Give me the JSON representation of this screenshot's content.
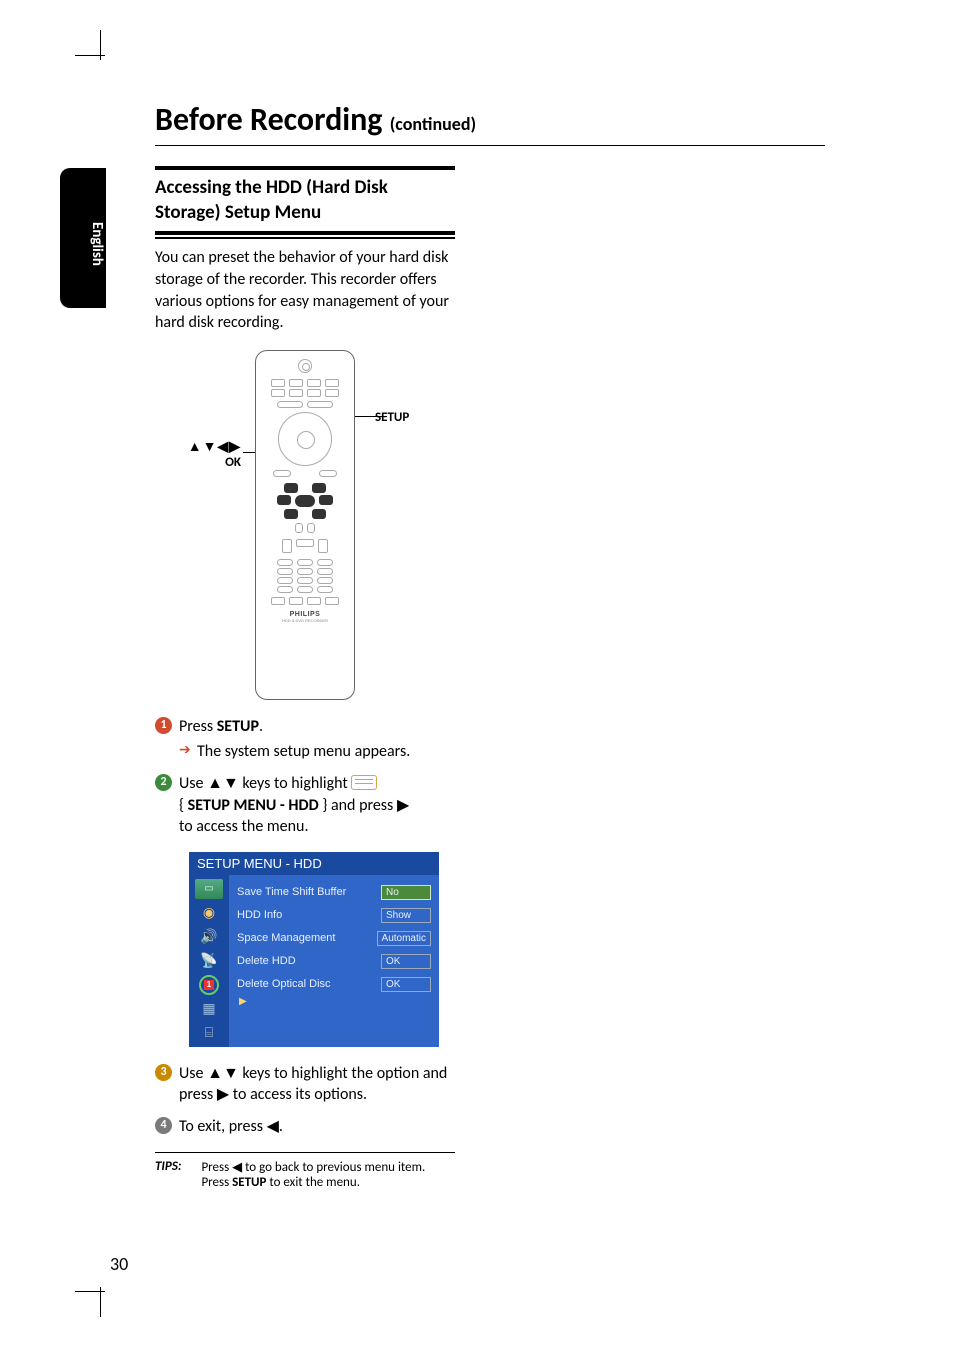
{
  "language_tab": "English",
  "title_main": "Before Recording",
  "title_cont": "(continued)",
  "section_heading": "Accessing the  HDD (Hard Disk Storage) Setup Menu",
  "intro": "You can preset the behavior of your hard disk storage of the recorder. This recorder offers various options for easy management of your hard disk recording.",
  "callout_left_arrows": "▲▼◀▶",
  "callout_left_ok": "OK",
  "callout_right": "SETUP",
  "remote_brand": "PHILIPS",
  "remote_sub": "HDD & DVD RECORDER",
  "steps": {
    "s1_a": "Press ",
    "s1_b": "SETUP",
    "s1_c": ".",
    "s1_result": "The system setup menu appears.",
    "s2_a": "Use ",
    "s2_keys": "▲▼",
    "s2_b": " keys to highlight ",
    "s2_c": "{ ",
    "s2_menu": "SETUP MENU - HDD",
    "s2_d": " } and press ",
    "s2_arrow": "▶",
    "s2_e": " to access the menu.",
    "s3_a": "Use ",
    "s3_keys": "▲▼",
    "s3_b": " keys to highlight the option and press ",
    "s3_arrow": "▶",
    "s3_c": " to access its options.",
    "s4_a": "To exit, press ",
    "s4_arrow": "◀",
    "s4_b": "."
  },
  "menu": {
    "title": "SETUP MENU - HDD",
    "rows": [
      {
        "label": "Save Time Shift Buffer",
        "value": "No"
      },
      {
        "label": "HDD Info",
        "value": "Show"
      },
      {
        "label": "Space Management",
        "value": "Automatic"
      },
      {
        "label": "Delete HDD",
        "value": "OK"
      },
      {
        "label": "Delete Optical Disc",
        "value": "OK"
      }
    ]
  },
  "tips": {
    "label": "TIPS:",
    "line1_a": "Press ",
    "line1_arrow": "◀",
    "line1_b": " to go back to previous menu item.",
    "line2_a": "Press ",
    "line2_b": "SETUP",
    "line2_c": " to exit the menu."
  },
  "page_number": "30"
}
